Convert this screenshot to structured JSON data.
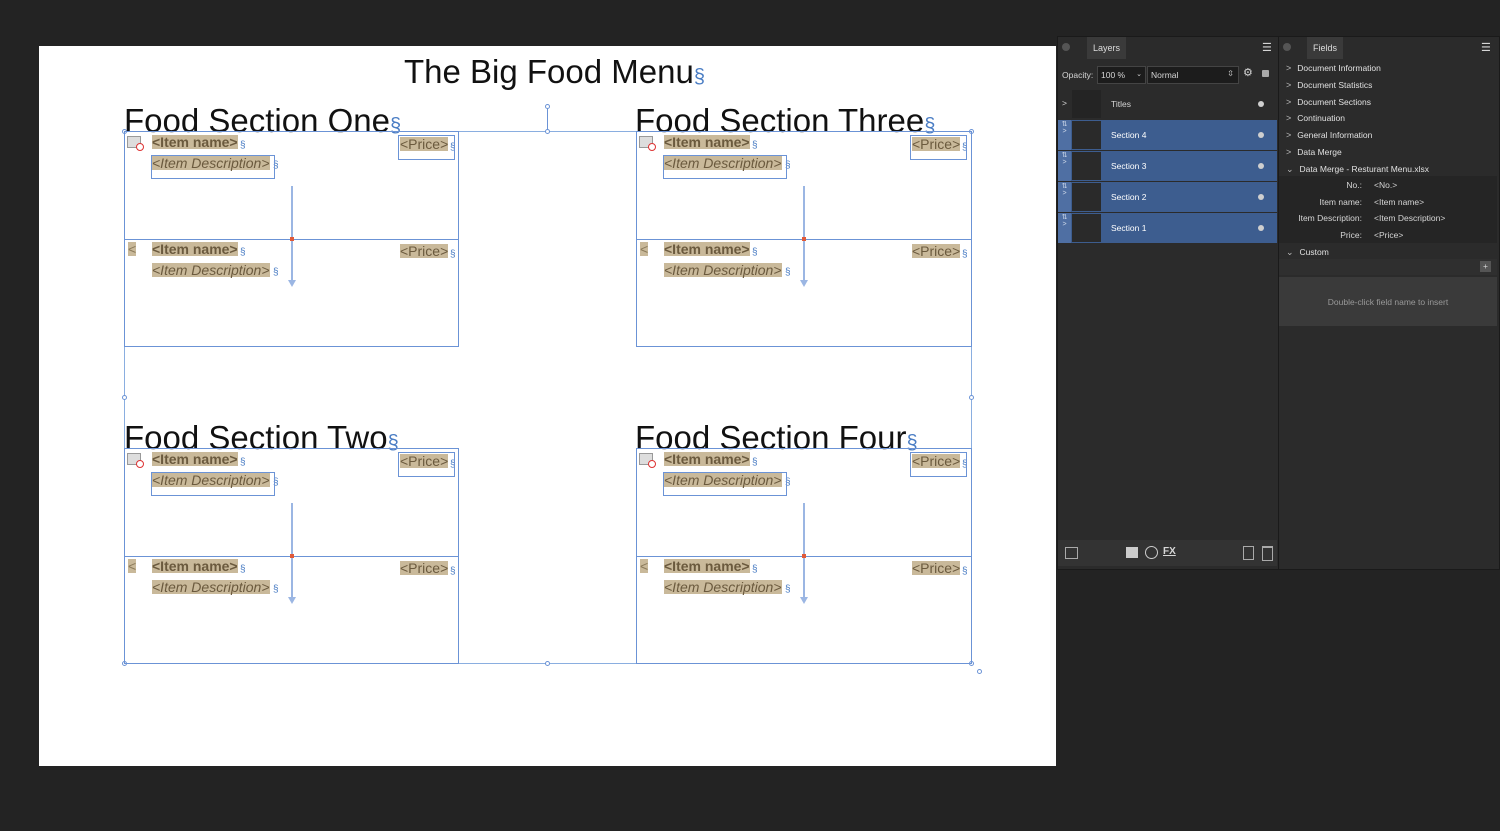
{
  "document": {
    "title": "The Big Food Menu",
    "pilcrow": "§",
    "sections": [
      {
        "title": "Food Section One",
        "item_name": "<Item name>",
        "item_desc": "<Item Description>",
        "price": "<Price>",
        "lt": "<"
      },
      {
        "title": "Food Section Three",
        "item_name": "<Item name>",
        "item_desc": "<Item Description>",
        "price": "<Price>",
        "lt": "<"
      },
      {
        "title": "Food Section Two",
        "item_name": "<Item name>",
        "item_desc": "<Item Description>",
        "price": "<Price>",
        "lt": "<"
      },
      {
        "title": "Food Section Four",
        "item_name": "<Item name>",
        "item_desc": "<Item Description>",
        "price": "<Price>",
        "lt": "<"
      }
    ]
  },
  "layers_panel": {
    "tab": "Layers",
    "opacity_label": "Opacity:",
    "opacity_value": "100 %",
    "blend_mode": "Normal",
    "layers": [
      {
        "name": "Titles",
        "selected": false
      },
      {
        "name": "Section 4",
        "selected": true
      },
      {
        "name": "Section 3",
        "selected": true
      },
      {
        "name": "Section 2",
        "selected": true
      },
      {
        "name": "Section 1",
        "selected": true
      }
    ]
  },
  "fields_panel": {
    "tab": "Fields",
    "groups": [
      "Document Information",
      "Document Statistics",
      "Document Sections",
      "Continuation",
      "General Information",
      "Data Merge",
      "Data Merge - Resturant Menu.xlsx"
    ],
    "merge_fields": [
      {
        "label": "No.:",
        "value": "<No.>"
      },
      {
        "label": "Item name:",
        "value": "<Item name>"
      },
      {
        "label": "Item Description:",
        "value": "<Item Description>"
      },
      {
        "label": "Price:",
        "value": "<Price>"
      }
    ],
    "custom_label": "Custom",
    "add_label": "+",
    "hint": "Double-click field name to insert"
  },
  "colors": {
    "selection": "#6b93d6",
    "layer_selected": "#3d5d8f",
    "field_highlight": "#c9b99a"
  }
}
